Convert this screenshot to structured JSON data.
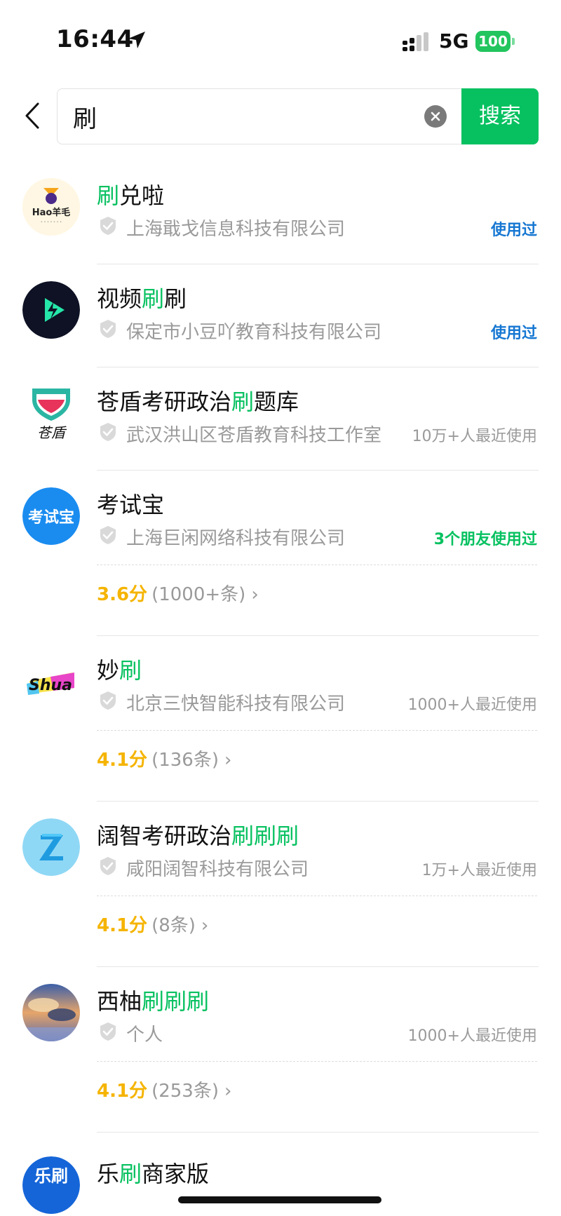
{
  "status": {
    "time": "16:44",
    "network": "5G",
    "battery": "100"
  },
  "search": {
    "query": "刷",
    "button_label": "搜索"
  },
  "results": [
    {
      "name_parts": [
        {
          "t": "刷",
          "hl": true
        },
        {
          "t": "兑啦",
          "hl": false
        }
      ],
      "company": "上海戢戈信息科技有限公司",
      "tag": "使用过",
      "tag_type": "blue",
      "logo": "hao-yangmao-logo",
      "logo_text": "Hao羊毛"
    },
    {
      "name_parts": [
        {
          "t": "视频",
          "hl": false
        },
        {
          "t": "刷",
          "hl": true
        },
        {
          "t": "刷",
          "hl": false
        }
      ],
      "company": "保定市小豆吖教育科技有限公司",
      "tag": "使用过",
      "tag_type": "blue",
      "logo": "video-play-logo"
    },
    {
      "name_parts": [
        {
          "t": "苍盾考研政治",
          "hl": false
        },
        {
          "t": "刷",
          "hl": true
        },
        {
          "t": "题库",
          "hl": false
        }
      ],
      "company": "武汉洪山区苍盾教育科技工作室",
      "tag": "10万+人最近使用",
      "tag_type": "gray",
      "logo": "cangdun-shield-logo",
      "logo_text": "苍盾"
    },
    {
      "name_parts": [
        {
          "t": "考试宝",
          "hl": false
        }
      ],
      "company": "上海巨闲网络科技有限公司",
      "tag": "3个朋友使用过",
      "tag_type": "green",
      "rating": {
        "score": "3.6分",
        "count": "(1000+条)"
      },
      "logo": "kaoshibao-logo",
      "logo_text": "考试宝"
    },
    {
      "name_parts": [
        {
          "t": "妙",
          "hl": false
        },
        {
          "t": "刷",
          "hl": true
        }
      ],
      "company": "北京三快智能科技有限公司",
      "tag": "1000+人最近使用",
      "tag_type": "gray",
      "rating": {
        "score": "4.1分",
        "count": "(136条)"
      },
      "logo": "shua-logo",
      "logo_text": "Shua"
    },
    {
      "name_parts": [
        {
          "t": "阔智考研政治",
          "hl": false
        },
        {
          "t": "刷刷刷",
          "hl": true
        }
      ],
      "company": "咸阳阔智科技有限公司",
      "tag": "1万+人最近使用",
      "tag_type": "gray",
      "rating": {
        "score": "4.1分",
        "count": "(8条)"
      },
      "logo": "z-logo",
      "logo_text": "Z"
    },
    {
      "name_parts": [
        {
          "t": "西柚",
          "hl": false
        },
        {
          "t": "刷刷刷",
          "hl": true
        }
      ],
      "company": "个人",
      "tag": "1000+人最近使用",
      "tag_type": "gray",
      "rating": {
        "score": "4.1分",
        "count": "(253条)"
      },
      "logo": "sky-painting-avatar"
    },
    {
      "name_parts": [
        {
          "t": "乐",
          "hl": false
        },
        {
          "t": "刷",
          "hl": true
        },
        {
          "t": "商家版",
          "hl": false
        }
      ],
      "logo": "leshua-logo",
      "logo_text": "乐刷"
    }
  ],
  "colors": {
    "accent_green": "#07c160",
    "tag_blue": "#1677d2",
    "rating_yellow": "#f5b400"
  }
}
